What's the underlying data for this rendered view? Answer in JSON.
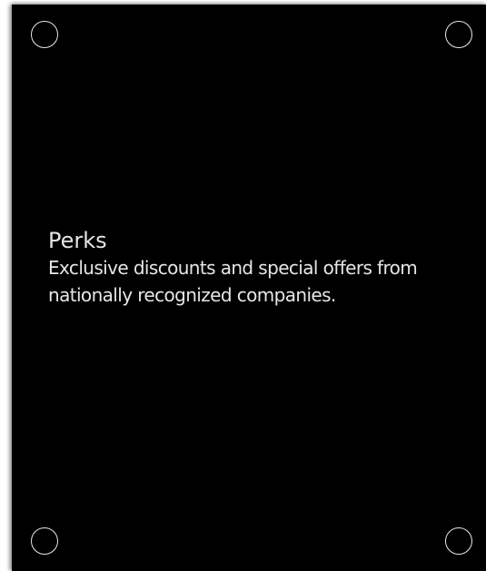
{
  "card": {
    "title": "Perks",
    "description": "Exclusive discounts and special offers from nationally recognized companies."
  },
  "colors": {
    "panel_background": "#000000",
    "text": "#e6e6e6",
    "screw_outline": "#e8e8e8"
  },
  "icons": {
    "corners": [
      "screw-icon",
      "screw-icon",
      "screw-icon",
      "screw-icon"
    ]
  }
}
